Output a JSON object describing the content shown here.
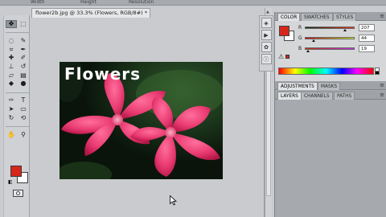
{
  "menu_strip": {
    "fragments": [
      "Width",
      "Height",
      "Resolution"
    ]
  },
  "document": {
    "tab_title": "flower2b.jpg @ 33.3% (Flowers, RGB/8#) *",
    "close_glyph": "×",
    "image_text": "Flowers"
  },
  "toolbox": {
    "tools": [
      {
        "name": "move-tool-icon",
        "glyph": "✥"
      },
      {
        "name": "marquee-tool-icon",
        "glyph": "⬚"
      },
      {
        "name": "lasso-tool-icon",
        "glyph": "◌"
      },
      {
        "name": "quick-select-tool-icon",
        "glyph": "✎"
      },
      {
        "name": "crop-tool-icon",
        "glyph": "⌗"
      },
      {
        "name": "eyedropper-tool-icon",
        "glyph": "✒"
      },
      {
        "name": "healing-brush-tool-icon",
        "glyph": "✚"
      },
      {
        "name": "brush-tool-icon",
        "glyph": "✐"
      },
      {
        "name": "clone-stamp-tool-icon",
        "glyph": "⊥"
      },
      {
        "name": "history-brush-tool-icon",
        "glyph": "↺"
      },
      {
        "name": "eraser-tool-icon",
        "glyph": "▱"
      },
      {
        "name": "gradient-tool-icon",
        "glyph": "▤"
      },
      {
        "name": "blur-tool-icon",
        "glyph": "◆"
      },
      {
        "name": "dodge-tool-icon",
        "glyph": "●"
      },
      {
        "name": "pen-tool-icon",
        "glyph": "✑"
      },
      {
        "name": "type-tool-icon",
        "glyph": "T"
      },
      {
        "name": "path-select-tool-icon",
        "glyph": "➤"
      },
      {
        "name": "shape-tool-icon",
        "glyph": "▭"
      },
      {
        "name": "3d-rotate-tool-icon",
        "glyph": "↻"
      },
      {
        "name": "3d-orbit-tool-icon",
        "glyph": "⟲"
      },
      {
        "name": "hand-tool-icon",
        "glyph": "✋"
      },
      {
        "name": "zoom-tool-icon",
        "glyph": "⚲"
      }
    ],
    "default_colors_glyph": "◧"
  },
  "color_panel": {
    "tabs": [
      "COLOR",
      "SWATCHES",
      "STYLES"
    ],
    "menu_glyph": "≡",
    "foreground": "#d7261b",
    "background": "#ffffff",
    "channels": [
      {
        "label": "R",
        "value": "207",
        "level": 0.81
      },
      {
        "label": "G",
        "value": "44",
        "level": 0.17
      },
      {
        "label": "B",
        "value": "19",
        "level": 0.07
      }
    ],
    "warning_glyph": "⚠"
  },
  "adjustments_panel": {
    "tabs": [
      "ADJUSTMENTS",
      "MASKS"
    ]
  },
  "layers_panel": {
    "tabs": [
      "LAYERS",
      "CHANNELS",
      "PATHS"
    ]
  },
  "dock_icons": [
    {
      "name": "history-panel-icon",
      "glyph": "◈"
    },
    {
      "name": "actions-panel-icon",
      "glyph": "▶"
    },
    {
      "name": "brushes-panel-icon",
      "glyph": "✿"
    },
    {
      "name": "info-panel-icon",
      "glyph": "ⓘ"
    }
  ]
}
